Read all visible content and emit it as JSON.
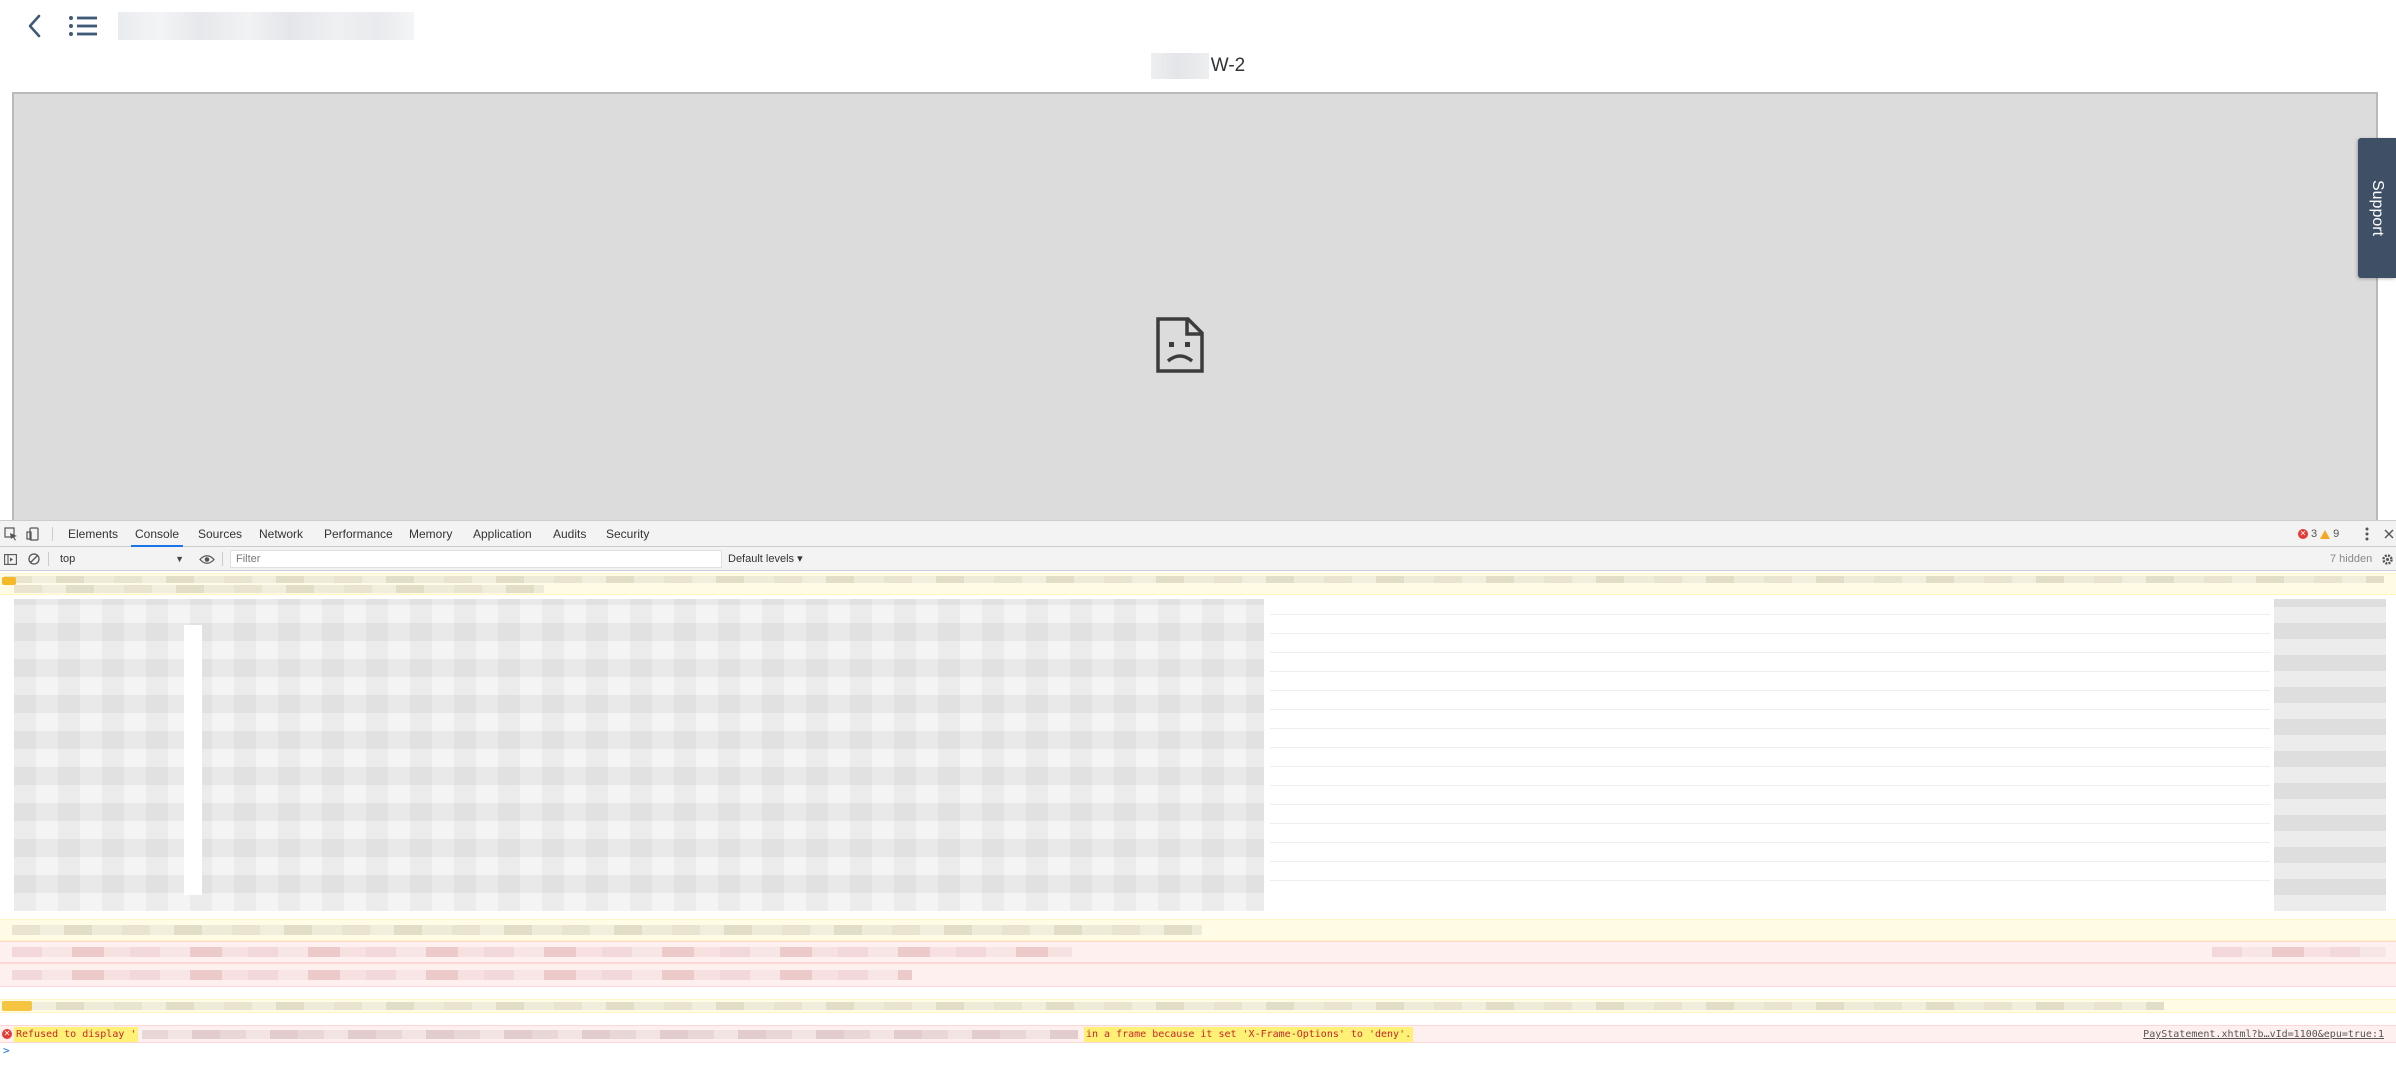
{
  "page": {
    "document_title": "W-2",
    "support_label": "Support"
  },
  "devtools": {
    "tabs": [
      {
        "label": "Elements"
      },
      {
        "label": "Console"
      },
      {
        "label": "Sources"
      },
      {
        "label": "Network"
      },
      {
        "label": "Performance"
      },
      {
        "label": "Memory"
      },
      {
        "label": "Application"
      },
      {
        "label": "Audits"
      },
      {
        "label": "Security"
      }
    ],
    "active_tab": "Console",
    "error_count": "3",
    "warning_count": "9",
    "context": "top",
    "filter_placeholder": "Filter",
    "levels_label": "Default levels ▾",
    "hidden_label": "7 hidden",
    "console": {
      "error_prefix": "Refused to display '",
      "error_suffix": "in a frame because it set 'X-Frame-Options' to 'deny'.",
      "source_link": "PayStatement.xhtml?b…vId=1100&epu=true:1",
      "prompt": ">"
    }
  },
  "colors": {
    "active_tab_underline": "#1a73e8",
    "support_tab": "#3f5066",
    "error": "#e53935",
    "warning": "#f5a623"
  }
}
